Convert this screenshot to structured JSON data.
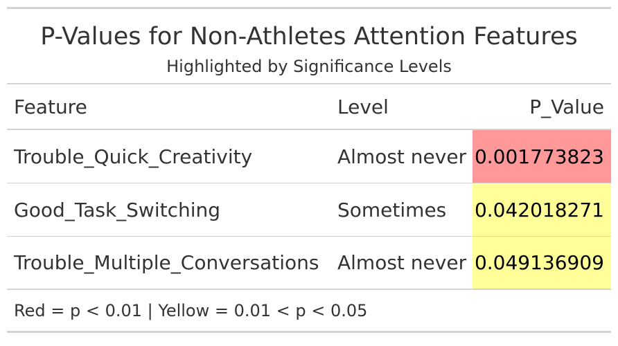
{
  "table": {
    "title": "P-Values for Non-Athletes Attention Features",
    "subtitle": "Highlighted by Significance Levels",
    "columns": [
      "Feature",
      "Level",
      "P_Value"
    ],
    "rows": [
      {
        "feature": "Trouble_Quick_Creativity",
        "level": "Almost never",
        "p_value": "0.001773823",
        "highlight": "#ff9999"
      },
      {
        "feature": "Good_Task_Switching",
        "level": "Sometimes",
        "p_value": "0.042018271",
        "highlight": "#ffff99"
      },
      {
        "feature": "Trouble_Multiple_Conversations",
        "level": "Almost never",
        "p_value": "0.049136909",
        "highlight": "#ffff99"
      }
    ],
    "footnote": "Red = p < 0.01 | Yellow = 0.01 < p < 0.05"
  },
  "colors": {
    "significant_red": "#ff9999",
    "marginal_yellow": "#ffff99",
    "rule": "#d3d3d3",
    "text": "#333333"
  }
}
